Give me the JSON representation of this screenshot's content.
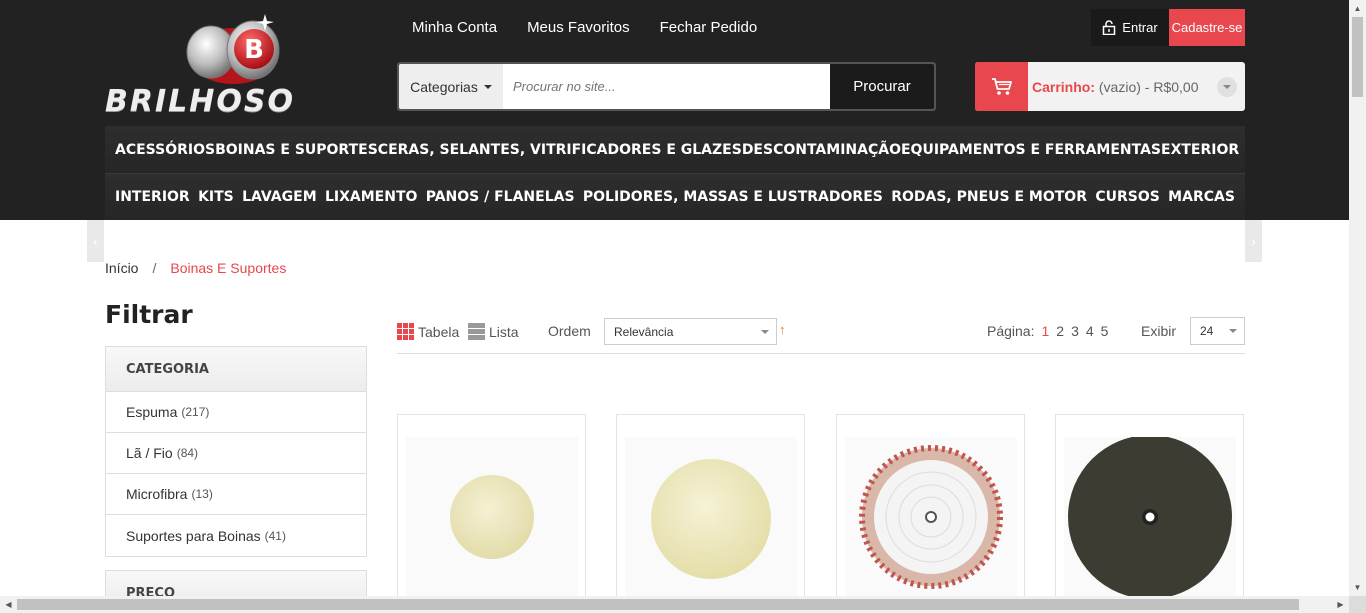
{
  "brand": {
    "name": "BRILHOSO",
    "logo_letter": "B"
  },
  "top_links": [
    "Minha Conta",
    "Meus Favoritos",
    "Fechar Pedido"
  ],
  "account": {
    "login_label": "Entrar",
    "register_label": "Cadastre-se"
  },
  "search": {
    "category_label": "Categorias",
    "placeholder": "Procurar no site...",
    "button_label": "Procurar"
  },
  "cart": {
    "label": "Carrinho:",
    "status": "(vazio) - R$0,00"
  },
  "nav": {
    "row1": [
      "ACESSÓRIOS",
      "BOINAS E SUPORTES",
      "CERAS, SELANTES, VITRIFICADORES E GLAZES",
      "DESCONTAMINAÇÃO",
      "EQUIPAMENTOS E FERRAMENTAS",
      "EXTERIOR"
    ],
    "row2": [
      "INTERIOR",
      "KITS",
      "LAVAGEM",
      "LIXAMENTO",
      "PANOS / FLANELAS",
      "POLIDORES, MASSAS E LUSTRADORES",
      "RODAS, PNEUS E MOTOR",
      "CURSOS",
      "MARCAS"
    ]
  },
  "breadcrumb": {
    "home": "Início",
    "separator": "/",
    "current": "Boinas E Suportes"
  },
  "filter": {
    "title": "Filtrar",
    "category_heading": "CATEGORIA",
    "categories": [
      {
        "label": "Espuma",
        "count": "(217)"
      },
      {
        "label": "Lã / Fio",
        "count": "(84)"
      },
      {
        "label": "Microfibra",
        "count": "(13)"
      },
      {
        "label": "Suportes para Boinas",
        "count": "(41)"
      }
    ],
    "price_heading": "PREÇO"
  },
  "toolbar": {
    "view_grid": "Tabela",
    "view_list": "Lista",
    "order_label": "Ordem",
    "order_value": "Relevância",
    "sort_arrow": "↑",
    "page_label": "Página:",
    "pages": [
      "1",
      "2",
      "3",
      "4",
      "5"
    ],
    "current_page": "1",
    "show_label": "Exibir",
    "show_value": "24"
  },
  "products": [
    {
      "image": "foam-pad-small-cream"
    },
    {
      "image": "foam-pad-large-cream"
    },
    {
      "image": "wool-pad-white"
    },
    {
      "image": "foam-pad-black"
    }
  ],
  "colors": {
    "accent": "#e8484d",
    "header_bg": "#222222",
    "sort_arrow": "#e27d2a"
  }
}
